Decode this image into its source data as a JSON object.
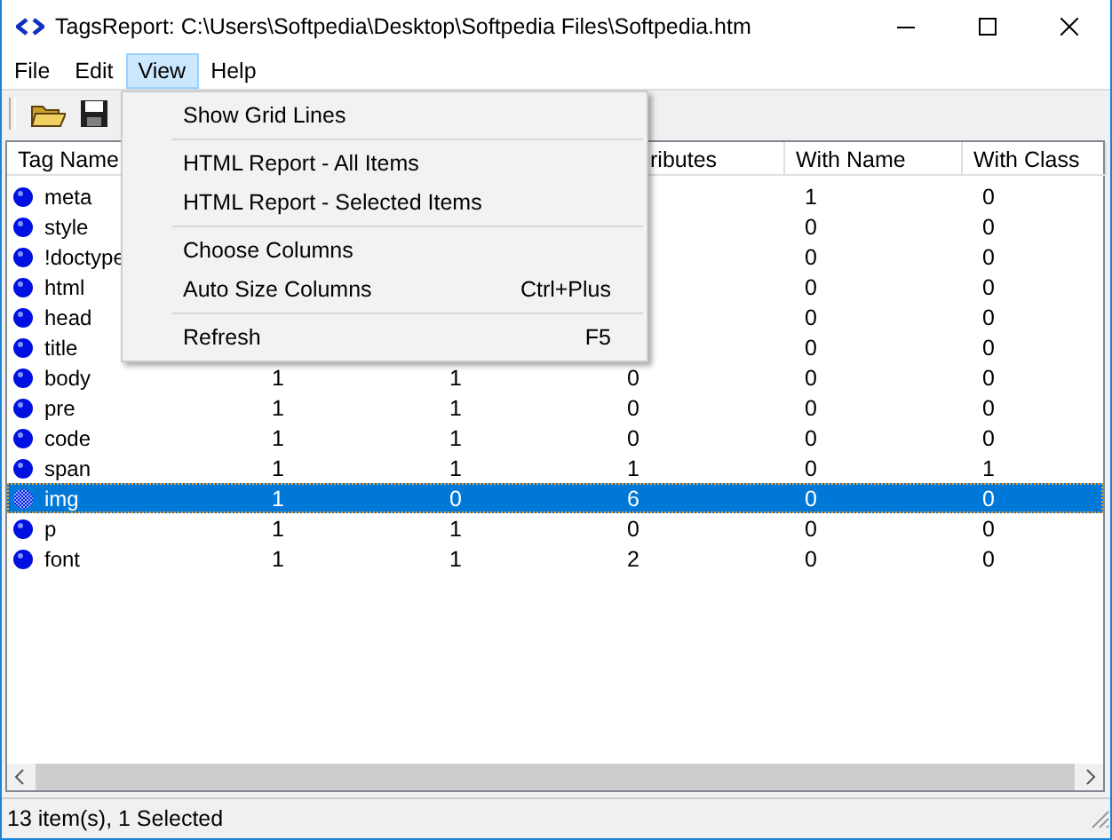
{
  "window": {
    "title": "TagsReport: C:\\Users\\Softpedia\\Desktop\\Softpedia Files\\Softpedia.htm"
  },
  "menubar": [
    {
      "label": "File",
      "selected": false
    },
    {
      "label": "Edit",
      "selected": false
    },
    {
      "label": "View",
      "selected": true
    },
    {
      "label": "Help",
      "selected": false
    }
  ],
  "view_menu": [
    {
      "kind": "item",
      "label": "Show Grid Lines"
    },
    {
      "kind": "separator"
    },
    {
      "kind": "item",
      "label": "HTML Report - All Items"
    },
    {
      "kind": "item",
      "label": "HTML Report - Selected Items"
    },
    {
      "kind": "separator"
    },
    {
      "kind": "item",
      "label": "Choose Columns"
    },
    {
      "kind": "item",
      "label": "Auto Size Columns",
      "shortcut": "Ctrl+Plus"
    },
    {
      "kind": "separator"
    },
    {
      "kind": "item",
      "label": "Refresh",
      "shortcut": "F5"
    }
  ],
  "table": {
    "columns": [
      "Tag Name",
      "",
      "",
      "ributes",
      "With Name",
      "With Class"
    ],
    "rows": [
      {
        "cells": [
          "meta",
          "",
          "",
          "",
          "1",
          "0"
        ],
        "selected": false
      },
      {
        "cells": [
          "style",
          "",
          "",
          "",
          "0",
          "0"
        ],
        "selected": false
      },
      {
        "cells": [
          "!doctype",
          "",
          "",
          "",
          "0",
          "0"
        ],
        "selected": false
      },
      {
        "cells": [
          "html",
          "",
          "",
          "",
          "0",
          "0"
        ],
        "selected": false
      },
      {
        "cells": [
          "head",
          "",
          "",
          "",
          "0",
          "0"
        ],
        "selected": false
      },
      {
        "cells": [
          "title",
          "",
          "",
          "",
          "0",
          "0"
        ],
        "selected": false
      },
      {
        "cells": [
          "body",
          "1",
          "1",
          "0",
          "0",
          "0"
        ],
        "selected": false
      },
      {
        "cells": [
          "pre",
          "1",
          "1",
          "0",
          "0",
          "0"
        ],
        "selected": false
      },
      {
        "cells": [
          "code",
          "1",
          "1",
          "0",
          "0",
          "0"
        ],
        "selected": false
      },
      {
        "cells": [
          "span",
          "1",
          "1",
          "1",
          "0",
          "1"
        ],
        "selected": false
      },
      {
        "cells": [
          "img",
          "1",
          "0",
          "6",
          "0",
          "0"
        ],
        "selected": true
      },
      {
        "cells": [
          "p",
          "1",
          "1",
          "0",
          "0",
          "0"
        ],
        "selected": false
      },
      {
        "cells": [
          "font",
          "1",
          "1",
          "2",
          "0",
          "0"
        ],
        "selected": false
      }
    ]
  },
  "status_bar": {
    "text": "13 item(s), 1 Selected"
  }
}
